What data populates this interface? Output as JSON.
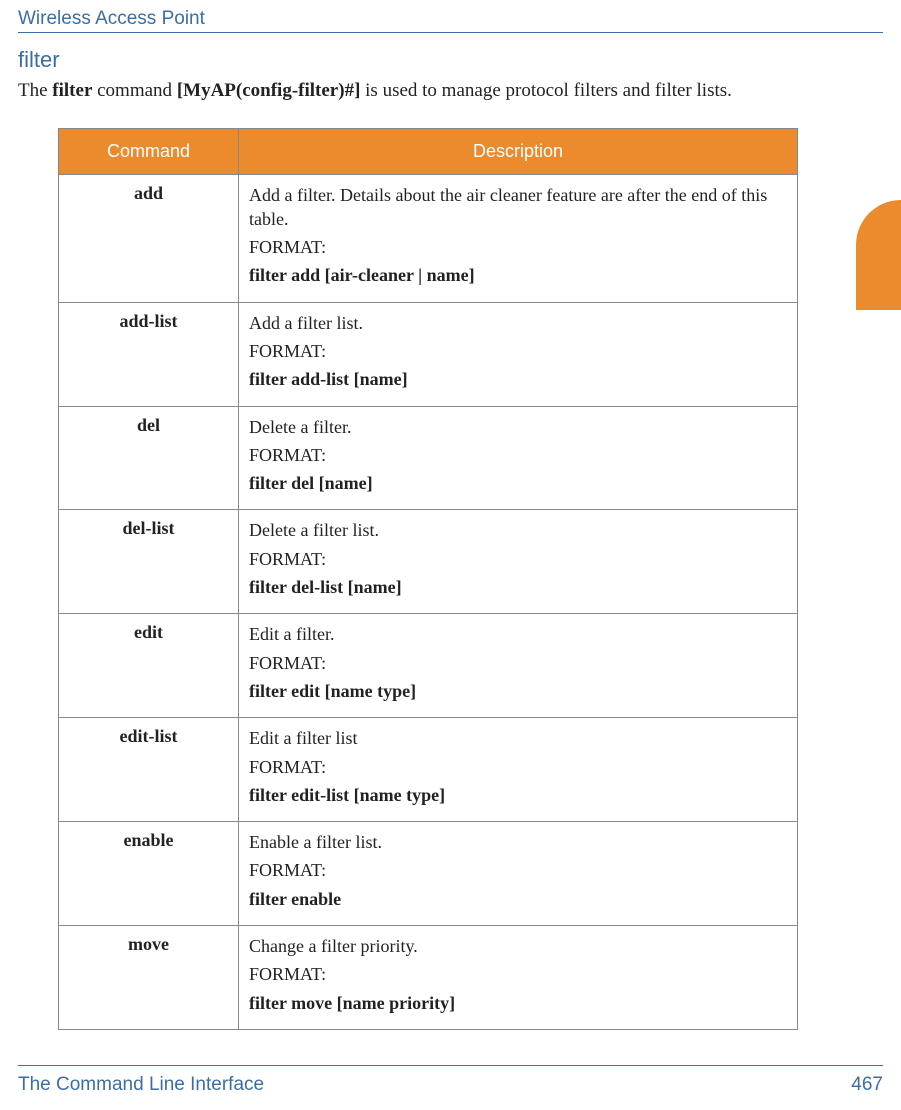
{
  "header": {
    "title": "Wireless Access Point"
  },
  "section": {
    "title": "filter",
    "intro_pre": "The ",
    "intro_b1": "filter",
    "intro_mid": " command ",
    "intro_b2": "[MyAP(config-filter)#]",
    "intro_post": " is used to manage protocol filters and filter lists."
  },
  "table": {
    "head_cmd": "Command",
    "head_desc": "Description",
    "rows": [
      {
        "cmd": "add",
        "desc1": "Add a filter. Details about the air cleaner feature are after the end of this table.",
        "desc2": "FORMAT:",
        "fmt": "filter add [air-cleaner | name]"
      },
      {
        "cmd": "add-list",
        "desc1": "Add a filter list.",
        "desc2": "FORMAT:",
        "fmt": "filter add-list [name]"
      },
      {
        "cmd": "del",
        "desc1": "Delete a filter.",
        "desc2": "FORMAT:",
        "fmt": "filter del [name]"
      },
      {
        "cmd": "del-list",
        "desc1": "Delete a filter list.",
        "desc2": "FORMAT:",
        "fmt": "filter del-list [name]"
      },
      {
        "cmd": "edit",
        "desc1": "Edit a filter.",
        "desc2": "FORMAT:",
        "fmt": "filter edit [name type]"
      },
      {
        "cmd": "edit-list",
        "desc1": "Edit a filter list",
        "desc2": "FORMAT:",
        "fmt": "filter edit-list [name type]"
      },
      {
        "cmd": "enable",
        "desc1": "Enable a filter list.",
        "desc2": "FORMAT:",
        "fmt": "filter enable"
      },
      {
        "cmd": "move",
        "desc1": "Change a filter priority.",
        "desc2": "FORMAT:",
        "fmt": "filter move [name priority]"
      }
    ]
  },
  "footer": {
    "left": "The Command Line Interface",
    "right": "467"
  }
}
